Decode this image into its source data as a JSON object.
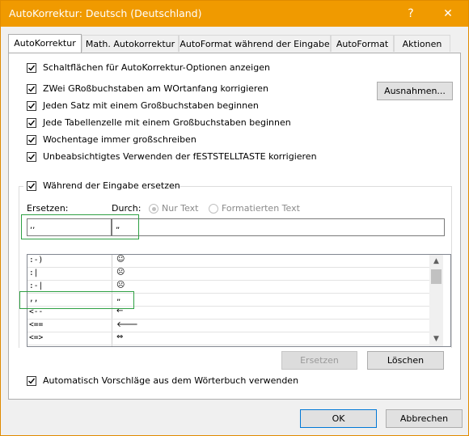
{
  "window": {
    "title": "AutoKorrektur: Deutsch (Deutschland)",
    "help_label": "?",
    "close_label": "✕"
  },
  "tabs": [
    {
      "label": "AutoKorrektur",
      "active": true
    },
    {
      "label": "Math. Autokorrektur",
      "active": false
    },
    {
      "label": "AutoFormat während der Eingabe",
      "active": false
    },
    {
      "label": "AutoFormat",
      "active": false
    },
    {
      "label": "Aktionen",
      "active": false
    }
  ],
  "options": {
    "show_buttons": {
      "label": "Schaltflächen für AutoKorrektur-Optionen anzeigen",
      "checked": true
    },
    "two_caps": {
      "label": "ZWei GRoßbuchstaben am WOrtanfang korrigieren",
      "checked": true
    },
    "sentence_cap": {
      "label": "Jeden Satz mit einem Großbuchstaben beginnen",
      "checked": true
    },
    "table_cell_cap": {
      "label": "Jede Tabellenzelle mit einem Großbuchstaben beginnen",
      "checked": true
    },
    "weekdays_cap": {
      "label": "Wochentage immer großschreiben",
      "checked": true
    },
    "caps_lock": {
      "label": "Unbeabsichtigtes Verwenden der fESTSTELLTASTE korrigieren",
      "checked": true
    },
    "replace_while_typing": {
      "label": "Während der Eingabe ersetzen",
      "checked": true
    },
    "dictionary_suggestions": {
      "label": "Automatisch Vorschläge aus dem Wörterbuch verwenden",
      "checked": true
    }
  },
  "buttons": {
    "exceptions": "Ausnahmen...",
    "replace": "Ersetzen",
    "delete": "Löschen",
    "ok": "OK",
    "cancel": "Abbrechen"
  },
  "replace_section": {
    "replace_label": "Ersetzen:",
    "with_label": "Durch:",
    "plain_text": "Nur Text",
    "formatted_text": "Formatierten Text",
    "replace_value": ",,",
    "with_value": "„"
  },
  "entries": [
    {
      "from": ":-)",
      "to": "☺"
    },
    {
      "from": ":|",
      "to": "☹"
    },
    {
      "from": ":-|",
      "to": "☹"
    },
    {
      "from": ",,",
      "to": "„"
    },
    {
      "from": "<--",
      "to": "←"
    },
    {
      "from": "<==",
      "to": "🡐"
    },
    {
      "from": "<=>",
      "to": "⇔"
    }
  ],
  "scrollbar": {
    "up_icon": "▲",
    "down_icon": "▼"
  }
}
